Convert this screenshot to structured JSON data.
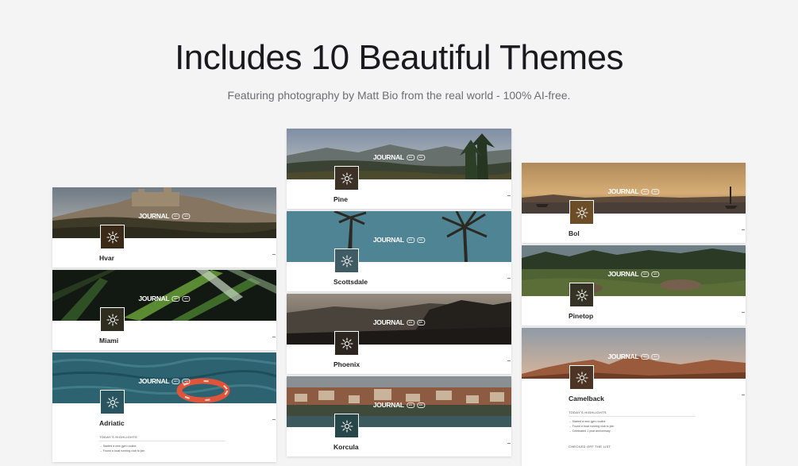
{
  "heading": "Includes 10 Beautiful Themes",
  "subheading": "Featuring photography by Matt Bio from the real world - 100% AI-free.",
  "journal_label": "JOURNAL",
  "pill_labels": [
    "EN",
    "EN"
  ],
  "sun_icon": "sun-icon",
  "columns": [
    {
      "cards": [
        {
          "name": "Hvar",
          "accent": "#3a2a17"
        },
        {
          "name": "Miami",
          "accent": "#2f2c20"
        },
        {
          "name": "Adriatic",
          "accent": "#2a5560",
          "highlights_title": "TODAY'S HIGHLIGHTS",
          "items": [
            "→ Started a new gym routine",
            "→ Found a local running club to join"
          ]
        }
      ]
    },
    {
      "cards": [
        {
          "name": "Pine",
          "accent": "#3b3124"
        },
        {
          "name": "Scottsdale",
          "accent": "#3f5c66"
        },
        {
          "name": "Phoenix",
          "accent": "#2c2520"
        },
        {
          "name": "Korcula",
          "accent": "#27464a"
        }
      ]
    },
    {
      "cards": [
        {
          "name": "Bol",
          "accent": "#6d4c28"
        },
        {
          "name": "Pinetop",
          "accent": "#353323"
        },
        {
          "name": "Camelback",
          "accent": "#4d3424",
          "highlights_title": "TODAY'S HIGHLIGHTS",
          "items": [
            "→ Started a new gym routine",
            "→ Found a local running club to join",
            "→ Celebrated 1 year anniversary"
          ],
          "checked_title": "CHECKED OFF THE LIST"
        }
      ]
    }
  ]
}
